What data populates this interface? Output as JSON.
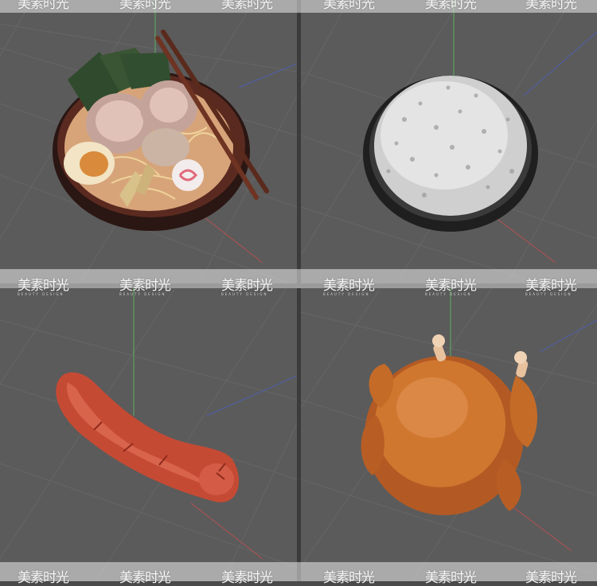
{
  "watermark": {
    "brand": "美素时光",
    "tagline": "BEAUTY DESIGN"
  },
  "viewports": [
    {
      "id": "ramen-bowl",
      "subject": "ramen-bowl-model"
    },
    {
      "id": "rice-bowl",
      "subject": "rice-bowl-model"
    },
    {
      "id": "sausage",
      "subject": "sausage-model"
    },
    {
      "id": "roast-chicken",
      "subject": "roast-chicken-model"
    }
  ],
  "colors": {
    "viewport_bg": "#5b5b5b",
    "grid_line": "#6a6a6a",
    "axis_green": "#5fae5f",
    "axis_red": "#b45050",
    "axis_blue": "#4f5fb0",
    "divider": "#3b3b3b"
  }
}
